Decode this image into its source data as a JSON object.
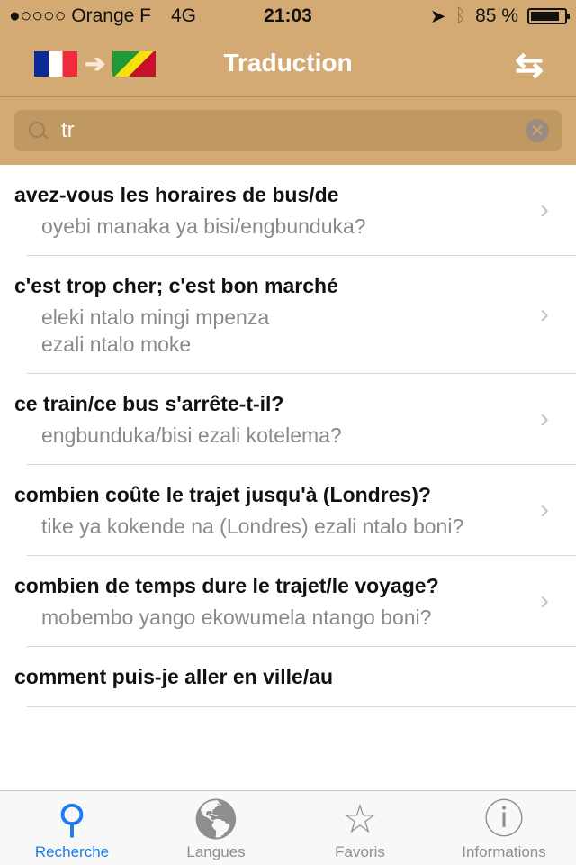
{
  "status": {
    "carrier": "●○○○○ Orange F",
    "network": "4G",
    "time": "21:03",
    "battery": "85 %",
    "battery_level": 0.85
  },
  "nav": {
    "title": "Traduction",
    "source_flag": "france",
    "target_flag": "congo",
    "swap_icon": "swap-arrows-icon"
  },
  "search": {
    "value": "tr",
    "placeholder": ""
  },
  "results": [
    {
      "fr": "avez-vous les horaires de bus/de",
      "ln": "oyebi manaka ya bisi/engbunduka?"
    },
    {
      "fr": "c'est trop cher; c'est bon marché",
      "ln": "eleki ntalo mingi mpenza\nezali ntalo moke"
    },
    {
      "fr": "ce train/ce bus s'arrête-t-il?",
      "ln": "engbunduka/bisi ezali kotelema?"
    },
    {
      "fr": "combien coûte le trajet jusqu'à (Londres)?",
      "ln": "tike ya kokende na (Londres) ezali ntalo boni?"
    },
    {
      "fr": "combien de temps dure le trajet/le voyage?",
      "ln": "mobembo yango ekowumela ntango boni?"
    },
    {
      "fr": "comment puis-je aller en ville/au",
      "ln": ""
    }
  ],
  "tabs": [
    {
      "label": "Recherche",
      "active": true
    },
    {
      "label": "Langues"
    },
    {
      "label": "Favoris"
    },
    {
      "label": "Informations"
    }
  ],
  "colors": {
    "header": "#d4aa74",
    "accent": "#1a7cf0"
  }
}
